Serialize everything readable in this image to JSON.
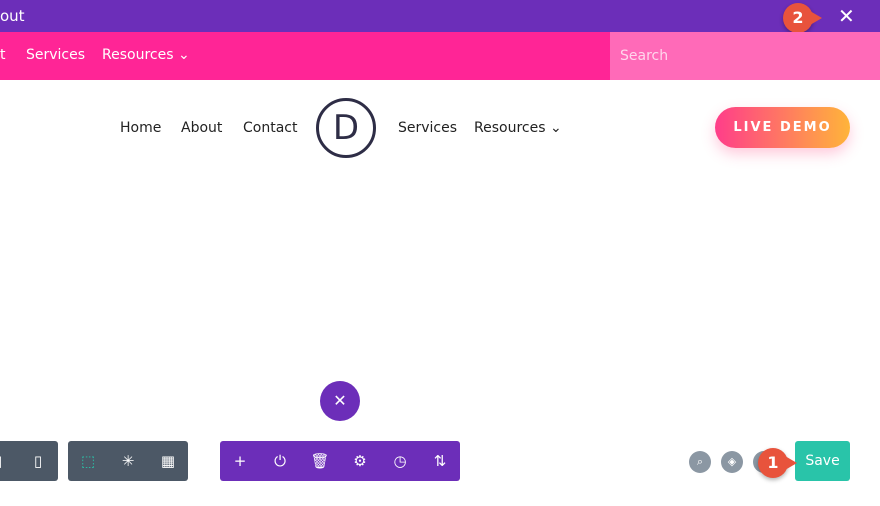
{
  "topbar": {
    "title": "out",
    "close_icon": "close-icon"
  },
  "navbar": {
    "items": [
      "t",
      "Services",
      "Resources ⌄"
    ],
    "search_placeholder": "Search"
  },
  "menu": {
    "left": [
      "Home",
      "About",
      "Contact"
    ],
    "right": [
      "Services",
      "Resources ⌄"
    ],
    "logo": "D",
    "cta": "LIVE DEMO"
  },
  "fab": "✕",
  "toolbar": {
    "left_icons": [
      "▯",
      "▯"
    ],
    "mid_icons": [
      "⬚",
      "✳",
      "▦"
    ],
    "purple_icons": [
      "+",
      "⏻",
      "🗑",
      "⚙",
      "◷",
      "⇅"
    ]
  },
  "right": {
    "search_icon": "⌕",
    "layers_icon": "◈",
    "save": "Save"
  },
  "annotations": {
    "one": "1",
    "two": "2"
  },
  "colors": {
    "accent": "#6c2eb9",
    "pink": "#ff2596",
    "save": "#29c4a9"
  }
}
